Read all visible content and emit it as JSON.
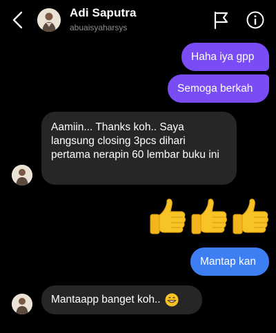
{
  "header": {
    "name": "Adi Saputra",
    "username": "abuaisyaharsys",
    "icons": [
      "chevron-left-icon",
      "flag-icon",
      "info-icon"
    ]
  },
  "messages": [
    {
      "side": "sent",
      "text": "Haha iya gpp"
    },
    {
      "side": "sent",
      "text": "Semoga berkah"
    },
    {
      "side": "received",
      "text": "Aamiin... Thanks koh.. Saya langsung closing 3pcs dihari pertama nerapin 60 lembar buku ini"
    },
    {
      "side": "sent",
      "emoji": [
        "thumbs-up",
        "thumbs-up",
        "thumbs-up"
      ]
    },
    {
      "side": "sent",
      "text": "Mantap kan"
    },
    {
      "side": "received",
      "text": "Mantaapp banget koh..",
      "emoji": "grinning-face"
    }
  ],
  "colors": {
    "background": "#000000",
    "sent_purple": "#7a4cf5",
    "sent_blue": "#3d7ff3",
    "received": "#262626",
    "username": "#8e8e93"
  }
}
